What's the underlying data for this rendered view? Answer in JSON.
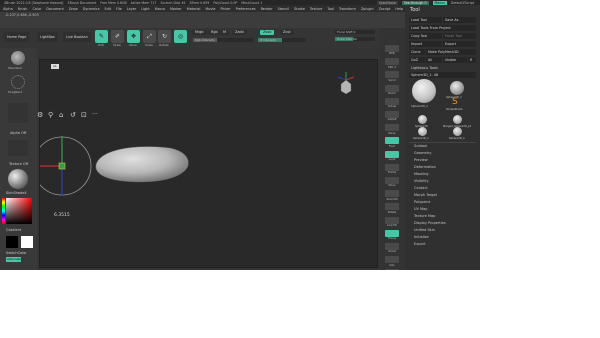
{
  "titlebar": {
    "items": [
      "ZBrush 2022.0.8 [Stephanie Howard]",
      "ZBrush Document",
      "Free Mem 0.6GB",
      "Active Mem 717",
      "Scratch Disk 49",
      "ATime 0.659",
      "PolyCount 0.0P",
      "MeshCount 1"
    ],
    "quicksave": "QuickSave",
    "see_through": "See-through 0",
    "menus": "Menus",
    "default_zscript": "DefaultZScript"
  },
  "menubar": {
    "items": [
      "Alpha",
      "Brush",
      "Color",
      "Document",
      "Draw",
      "Dynamics",
      "Edit",
      "File",
      "Layer",
      "Light",
      "Macro",
      "Marker",
      "Material",
      "Movie",
      "Picker",
      "Preferences",
      "Render",
      "Stencil",
      "Stroke",
      "Texture",
      "Tool",
      "Transform",
      "Zplugin",
      "Zscript",
      "Help"
    ]
  },
  "coordinates": "-0.237,0.486,-0.905",
  "shelf": {
    "home_page": "Home Page",
    "lightbox": "LightBox",
    "live_boolean": "Live Boolean",
    "buttons": [
      {
        "label": "Edit",
        "active": true,
        "icon": "edit-icon"
      },
      {
        "label": "Draw",
        "active": true,
        "icon": "draw-icon"
      },
      {
        "label": "Move",
        "active": false,
        "icon": "move-icon"
      },
      {
        "label": "Scale",
        "active": false,
        "icon": "scale-icon"
      },
      {
        "label": "Rotate",
        "active": true,
        "icon": "rotate-icon"
      }
    ],
    "mrgb": "Mrgb",
    "rgb": "Rgb",
    "m": "M",
    "zadd": "Zadd",
    "zsub": "Zsub",
    "zcut": "Zcut",
    "rgb_intensity": "Rgb Intensity",
    "z_intensity": "Z Intensity",
    "focal_shift": "Focal Shift 0",
    "draw_size": "Draw Size 64",
    "dynamic": "Dynamic"
  },
  "leftbar": {
    "brush_label": "Standard",
    "stroke_label": "DragRect",
    "alpha_label": "Alpha Off",
    "texture_label": "Texture Off",
    "material_label": "SkinShade4",
    "gradient": "Gradient",
    "switch_color": "SwitchColor",
    "alternate": "Alternate"
  },
  "viewport": {
    "readout": "6.3515",
    "tag": "AL"
  },
  "tool_panel": {
    "title": "Tool",
    "load_tool": "Load Tool",
    "save_as": "Save As",
    "load_tools_from_project": "Load Tools From Project",
    "copy_tool": "Copy Tool",
    "paste_tool": "Paste Tool",
    "import": "Import",
    "export": "Export",
    "clone": "Clone",
    "make_polymesh": "Make PolyMesh3D",
    "goz": "GoZ",
    "all": "All",
    "visible": "Visible",
    "r": "R",
    "lightbox_tools": "Lightbox ▸ Tools",
    "current_tool": "Sphere3D_1. 48",
    "thumbs": [
      {
        "label": "Sphere3D_1"
      },
      {
        "label": "Sphere3D_1"
      },
      {
        "label": "SimpleBrush"
      },
      {
        "label": "Sphere3D"
      },
      {
        "label": "Merged_Sphere3D_pt"
      },
      {
        "label": "Sphere3D_1"
      },
      {
        "label": "Sphere3D_1"
      }
    ],
    "subpalettes": [
      "Subtool",
      "Geometry",
      "Preview",
      "Deformation",
      "Masking",
      "Visibility",
      "Contact",
      "Morph Target",
      "Polypaint",
      "UV Map",
      "Texture Map",
      "Display Properties",
      "Unified Skin",
      "Initialize",
      "Export"
    ]
  },
  "rightbar": {
    "buttons": [
      "BPR",
      "SPix 3",
      "Scroll",
      "Zoom",
      "Actual",
      "AAHalf",
      "Persp",
      "Floor",
      "Local",
      "Frame",
      "Move",
      "Zoom3D",
      "Rotate",
      "Line Fill",
      "Transp",
      "Ghost",
      "Solo",
      "Xpose"
    ]
  },
  "colors": {
    "accent": "#47c7a6",
    "panel": "#303030",
    "viewport": "#292929",
    "mesh": "#c8c8c8"
  }
}
